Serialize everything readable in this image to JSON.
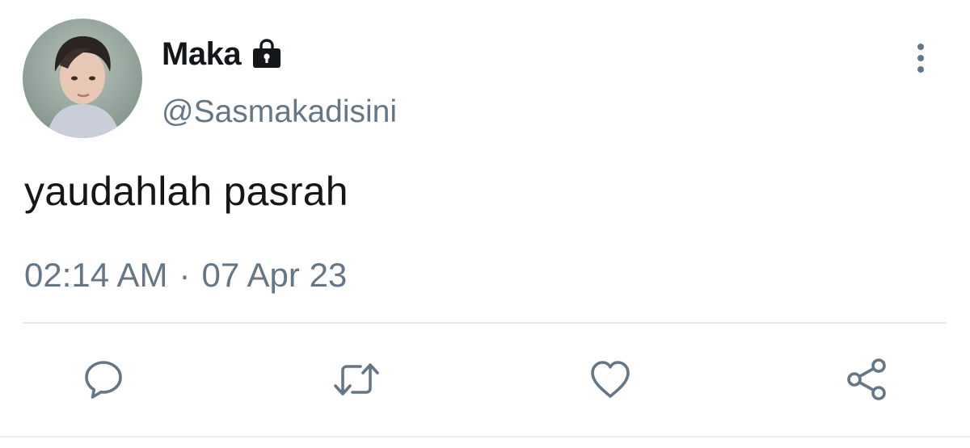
{
  "tweet": {
    "author": {
      "display_name": "Maka",
      "handle": "@Sasmakadisini",
      "protected_icon": "lock-icon",
      "avatar": "avatar"
    },
    "text": "yaudahlah pasrah",
    "time": "02:14 AM",
    "separator": "·",
    "date": "07 Apr 23",
    "menu_icon": "more-vertical-icon"
  },
  "actions": [
    {
      "icon": "reply-icon"
    },
    {
      "icon": "retweet-icon"
    },
    {
      "icon": "like-icon"
    },
    {
      "icon": "share-icon"
    }
  ],
  "colors": {
    "primary_text": "#14171a",
    "secondary_text": "#657786",
    "divider": "#e1e8ed",
    "background": "#ffffff"
  }
}
